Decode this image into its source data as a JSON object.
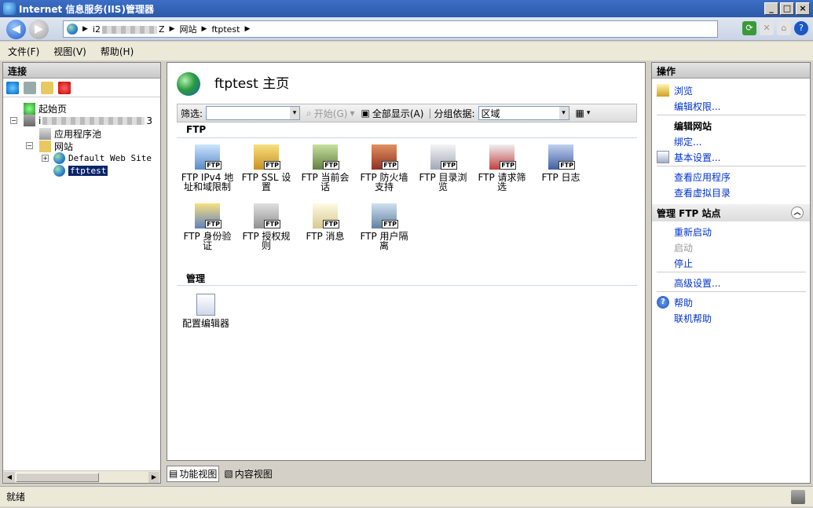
{
  "window": {
    "title": "Internet 信息服务(IIS)管理器"
  },
  "address": {
    "segments": [
      "i2",
      "Z",
      "网站",
      "ftptest"
    ]
  },
  "menu": [
    "文件(F)",
    "视图(V)",
    "帮助(H)"
  ],
  "connections": {
    "header": "连接",
    "tree": {
      "start_page": "起始页",
      "server": "i",
      "server_suffix": "3",
      "app_pools": "应用程序池",
      "sites": "网站",
      "default_site": "Default Web Site",
      "ftptest": "ftptest"
    }
  },
  "main": {
    "title": "ftptest 主页",
    "filter_label": "筛选:",
    "start_label": "开始(G)",
    "show_all_label": "全部显示(A)",
    "group_by_label": "分组依据:",
    "group_by_value": "区域",
    "sections": {
      "ftp": "FTP",
      "manage": "管理"
    },
    "ftp_features": [
      {
        "line1": "FTP IPv4 地",
        "line2": "址和域限制"
      },
      {
        "line1": "FTP SSL 设",
        "line2": "置"
      },
      {
        "line1": "FTP 当前会",
        "line2": "话"
      },
      {
        "line1": "FTP 防火墙",
        "line2": "支持"
      },
      {
        "line1": "FTP 目录浏",
        "line2": "览"
      },
      {
        "line1": "FTP 请求筛",
        "line2": "选"
      },
      {
        "line1": "FTP 日志",
        "line2": ""
      },
      {
        "line1": "FTP 身份验",
        "line2": "证"
      },
      {
        "line1": "FTP 授权规",
        "line2": "则"
      },
      {
        "line1": "FTP 消息",
        "line2": ""
      },
      {
        "line1": "FTP 用户隔",
        "line2": "离"
      }
    ],
    "manage_features": [
      {
        "line1": "配置编辑器",
        "line2": ""
      }
    ],
    "ftp_badge": "FTP"
  },
  "views": {
    "features": "功能视图",
    "content": "内容视图"
  },
  "actions": {
    "header": "操作",
    "browse": "浏览",
    "edit_permissions": "编辑权限...",
    "edit_site_heading": "编辑网站",
    "bindings": "绑定...",
    "basic_settings": "基本设置...",
    "view_apps": "查看应用程序",
    "view_vdirs": "查看虚拟目录",
    "manage_ftp_heading": "管理 FTP 站点",
    "restart": "重新启动",
    "start": "启动",
    "stop": "停止",
    "advanced": "高级设置...",
    "help": "帮助",
    "online_help": "联机帮助"
  },
  "status": {
    "text": "就绪"
  },
  "colors": {
    "title_bar": "#2c5aa8",
    "link": "#0033cc",
    "selected": "#0a246a"
  }
}
